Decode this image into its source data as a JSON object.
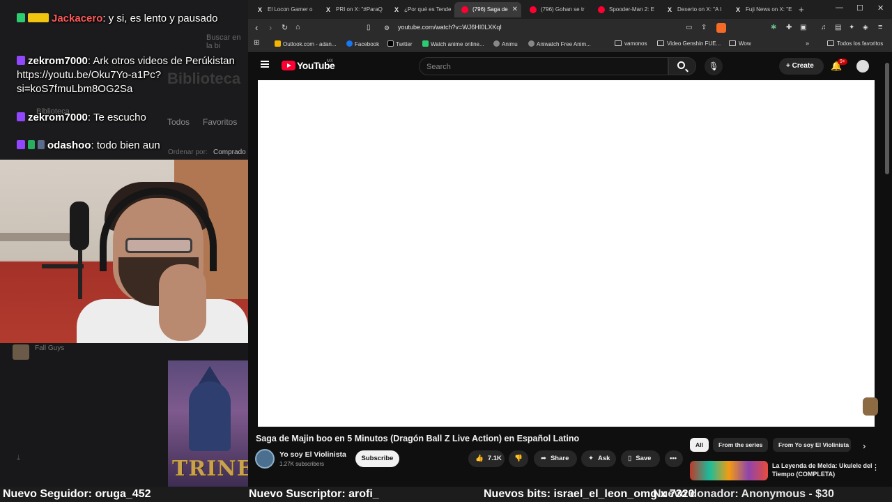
{
  "stream": {
    "chat": [
      {
        "user": "Jackacero",
        "user_color": "#ff5a5a",
        "text": ": y si, es lento y pausado",
        "badge_color": "#2ecc71"
      },
      {
        "user": "zekrom7000",
        "user_color": "#ffffff",
        "text": ": Ark otros videos de Perúkistan https://youtu.be/Oku7Yo-a1Pc?si=koS7fmuLbm8OG2Sa",
        "badge_color": "#9146ff"
      },
      {
        "user": "zekrom7000",
        "user_color": "#ffffff",
        "text": ": Te escucho",
        "badge_color": "#9146ff"
      },
      {
        "user": "odashoo",
        "user_color": "#ffffff",
        "text": ": todo bien aun",
        "badge_color": "#9146ff"
      }
    ],
    "ghost": {
      "search": "Buscar en la bi",
      "library": "Biblioteca",
      "library_small": "Biblioteca",
      "all": "Todos",
      "favorites": "Favoritos",
      "sort": "Ordenar por:",
      "sort_value": "Comprado"
    },
    "game_label": "Fall Guys",
    "trine_title": "TRINE"
  },
  "browser": {
    "tabs": [
      {
        "title": "El Locon Gamer o",
        "icon": "x",
        "active": false
      },
      {
        "title": "PRI on X: \"#ParaQ",
        "icon": "x",
        "active": false
      },
      {
        "title": "¿Por qué es Tende",
        "icon": "x",
        "active": false
      },
      {
        "title": "(796) Saga de",
        "icon": "yt",
        "active": true
      },
      {
        "title": "(796) Gohan se tr",
        "icon": "yt",
        "active": false
      },
      {
        "title": "Spooder-Man 2: E",
        "icon": "yt",
        "active": false
      },
      {
        "title": "Dexerto on X: \"A I",
        "icon": "x",
        "active": false
      },
      {
        "title": "Fuji News on X: \"E",
        "icon": "x",
        "active": false
      }
    ],
    "url": "youtube.com/watch?v=WJ6HI0LXKqI",
    "bookmarks": [
      {
        "label": "Outlook.com - adan...",
        "color": "#0078d4"
      },
      {
        "label": "Facebook",
        "color": "#1877f2"
      },
      {
        "label": "Twitter",
        "color": "#000000"
      },
      {
        "label": "Watch anime online...",
        "color": "#2ecc71"
      },
      {
        "label": "Animu",
        "color": "#888888"
      },
      {
        "label": "Aniwatch Free Anim...",
        "color": "#888888"
      },
      {
        "label": "vamonos",
        "color": "folder"
      },
      {
        "label": "Video Genshin FUE...",
        "color": "folder"
      },
      {
        "label": "Wow",
        "color": "folder"
      }
    ],
    "all_bookmarks": "Todos los favoritos"
  },
  "youtube": {
    "logo_text": "YouTube",
    "country": "MX",
    "search_placeholder": "Search",
    "create_label": "Create",
    "notifications": "9+",
    "video_title": "Saga de Majin boo en 5 Minutos (Dragón Ball Z Live Action) en Español Latino",
    "channel_name": "Yo soy El Violinista",
    "subscribers": "1.27K subscribers",
    "subscribe_label": "Subscribe",
    "likes": "7.1K",
    "share_label": "Share",
    "ask_label": "Ask",
    "save_label": "Save",
    "chips": [
      "All",
      "From the series",
      "From Yo soy El Violinista"
    ],
    "rec_title": "La Leyenda de Melda: Ukulele del Tiempo (COMPLETA)"
  },
  "alerts": {
    "follower": "Nuevo Seguidor: oruga_452",
    "subscriber": "Nuevo Suscriptor: arofi_",
    "bits": "Nuevos bits: israel_el_leon_omg x 7320",
    "donor": "Nuevo donador: Anonymous - $30"
  }
}
